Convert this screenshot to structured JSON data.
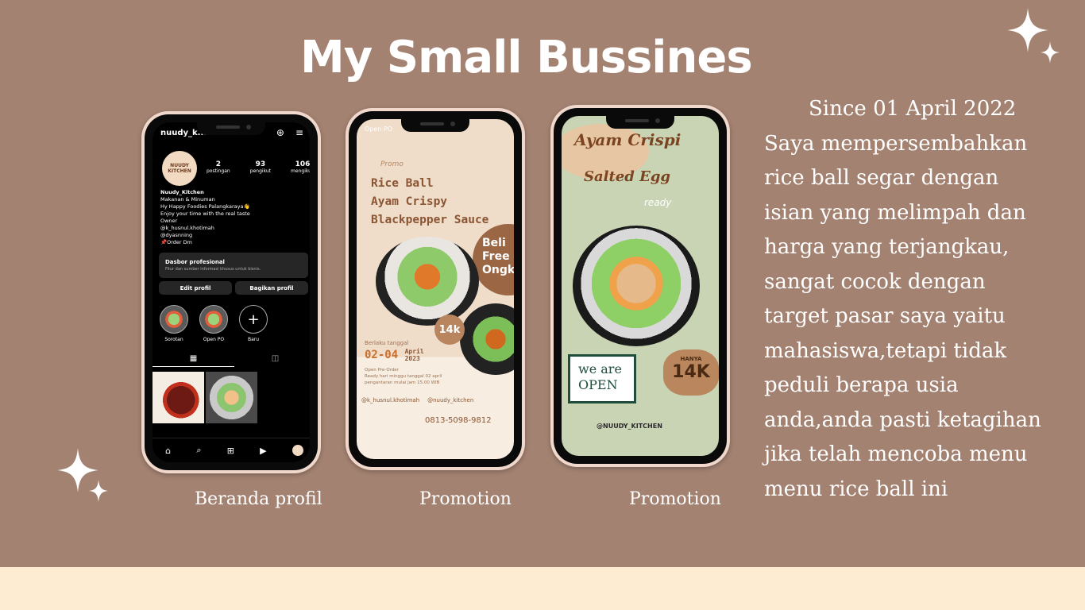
{
  "title": "My Small Bussines",
  "captions": [
    "Beranda profil",
    "Promotion",
    "Promotion"
  ],
  "description": {
    "since": "Since 01 April 2022",
    "lines": [
      "Saya mempersembahkan",
      "rice ball segar dengan",
      "isian yang melimpah dan",
      "harga yang terjangkau,",
      "sangat cocok dengan",
      "target pasar saya yaitu",
      "mahasiswa,tetapi tidak",
      "peduli berapa usia",
      "anda,anda pasti ketagihan",
      "jika telah mencoba menu",
      "menu rice ball ini"
    ]
  },
  "instagram": {
    "handle": "nuudy_k...",
    "stats": [
      {
        "num": "2",
        "label": "postingan"
      },
      {
        "num": "93",
        "label": "pengikut"
      },
      {
        "num": "106",
        "label": "mengikuti"
      }
    ],
    "avatar_text": "NUUDY KITCHEN",
    "bio": {
      "name": "Nuudy_Kitchen",
      "lines": [
        "Makanan & Minuman",
        "Hy Happy Foodies Palangkaraya👋",
        "Enjoy your time with the real taste",
        "Owner",
        "@k_husnul.khotimah",
        "@dyasnning",
        "📌Order Dm"
      ]
    },
    "dashboard_title": "Dasbor profesional",
    "dashboard_sub": "Fitur dan sumber informasi khusus untuk bisnis.",
    "edit_profile": "Edit profil",
    "share_profile": "Bagikan profil",
    "highlights": [
      "Sorotan",
      "Open PO",
      "Baru"
    ]
  },
  "promo1": {
    "header": "Open PO",
    "tag": "Promo",
    "headline": [
      "Rice Ball",
      "Ayam Crispy",
      "Blackpepper Sauce"
    ],
    "free": [
      "Beli",
      "Free",
      "Ongk"
    ],
    "price": "14k",
    "date_label": "Berlaku tanggal",
    "date": "02-04",
    "date_month": "April",
    "date_year": "2023",
    "info": [
      "Open Pre-Order",
      "Ready hari minggu tanggal 02 april",
      "pengantaran mulai jam 15.00 WIB"
    ],
    "social1": "@k_husnul.khotimah",
    "social2": "@nuudy_kitchen",
    "phone": "0813-5098-9812"
  },
  "promo2": {
    "headline1": "Ayam Crispi",
    "headline2": "Salted Egg",
    "ready": "ready",
    "sign_top": "we are",
    "sign_bottom": "OPEN",
    "badge_top": "HANYA",
    "badge_price": "14K",
    "handle": "@NUUDY_KITCHEN"
  },
  "colors": {
    "background": "#a38271",
    "footer": "#fdebd2",
    "text": "#ffffff"
  }
}
